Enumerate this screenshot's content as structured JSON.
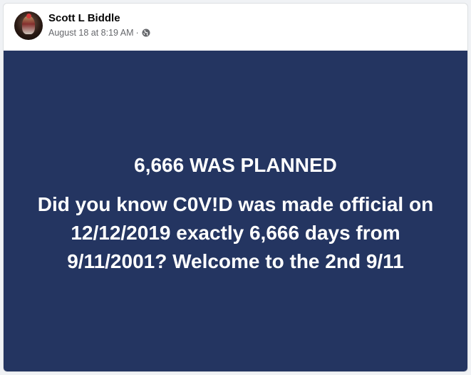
{
  "post": {
    "author": "Scott L Biddle",
    "timestamp": "August 18 at 8:19 AM",
    "separator": "·",
    "privacy_icon": "globe-icon"
  },
  "image": {
    "background_color": "#243561",
    "headline": "6,666 WAS PLANNED",
    "lines": [
      "Did you know C0V!D was made official on",
      "12/12/2019 exactly 6,666 days from",
      "9/11/2001? Welcome to the 2nd 9/11"
    ]
  }
}
